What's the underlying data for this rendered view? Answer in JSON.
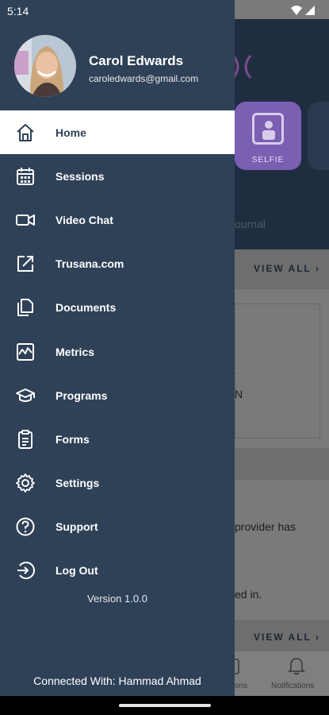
{
  "status_bar": {
    "time": "5:14",
    "wifi_icon": "wifi-icon",
    "signal_icon": "signal-icon",
    "battery_icon": "battery-icon"
  },
  "profile": {
    "name": "Carol Edwards",
    "email": "caroledwards@gmail.com"
  },
  "menu": {
    "items": [
      {
        "label": "Home",
        "icon": "home-icon",
        "active": true
      },
      {
        "label": "Sessions",
        "icon": "calendar-icon",
        "active": false
      },
      {
        "label": "Video Chat",
        "icon": "video-camera-icon",
        "active": false
      },
      {
        "label": "Trusana.com",
        "icon": "external-link-icon",
        "active": false
      },
      {
        "label": "Documents",
        "icon": "documents-icon",
        "active": false
      },
      {
        "label": "Metrics",
        "icon": "chart-icon",
        "active": false
      },
      {
        "label": "Programs",
        "icon": "graduation-cap-icon",
        "active": false
      },
      {
        "label": "Forms",
        "icon": "clipboard-icon",
        "active": false
      },
      {
        "label": "Settings",
        "icon": "gear-icon",
        "active": false
      },
      {
        "label": "Support",
        "icon": "question-icon",
        "active": false
      },
      {
        "label": "Log Out",
        "icon": "logout-icon",
        "active": false
      }
    ]
  },
  "version": "Version 1.0.0",
  "connected": "Connected With: Hammad Ahmad",
  "background": {
    "selfie_label": "SELFIE",
    "journal_label": "ournal",
    "view_all_1": "VIEW ALL",
    "view_all_2": "VIEW ALL",
    "card_text": "N",
    "provider_text": "provider has",
    "signed_text": "ed in.",
    "tab_sessions": "ons",
    "tab_notifications": "Notifications"
  },
  "colors": {
    "drawer_bg": "#2f4157",
    "active_bg": "#ffffff",
    "text_light": "#ffffff",
    "accent_purple": "#7b5fb3"
  }
}
